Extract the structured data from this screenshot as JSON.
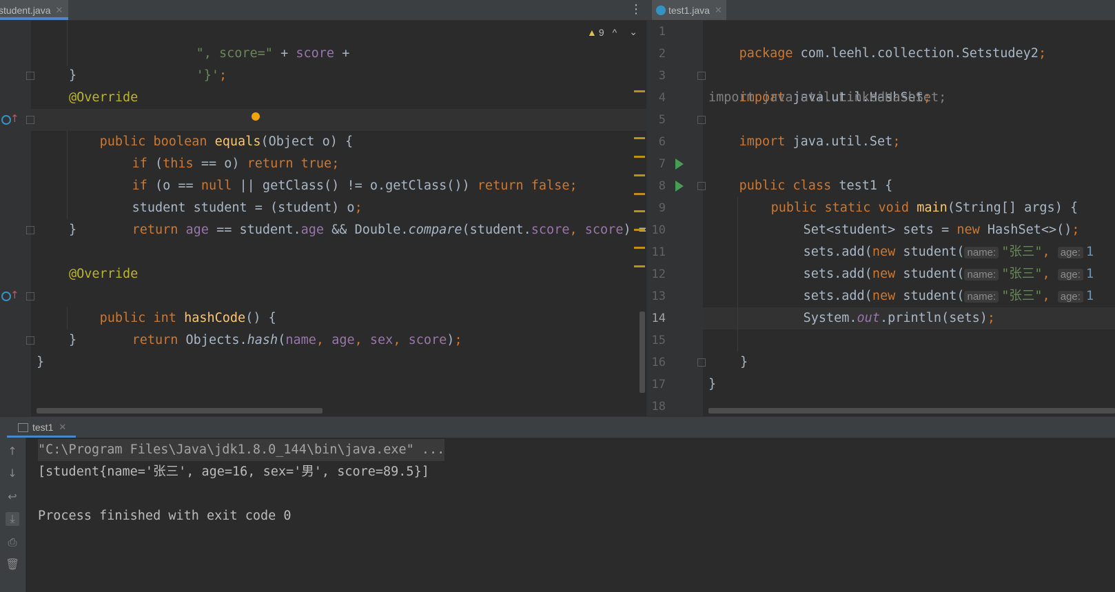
{
  "left_tab": {
    "label": "student.java",
    "close": "✕"
  },
  "left_menu_glyph": "⋮",
  "right_tab": {
    "label": "test1.java",
    "close": "✕"
  },
  "warnings": {
    "count": "9",
    "up": "^",
    "down": "⌄"
  },
  "left_code": {
    "l0": {
      "a": "\", score=\"",
      "b": " + ",
      "c": "score",
      "d": " +"
    },
    "l1": {
      "a": "'}'",
      "b": ";"
    },
    "l2": "}",
    "l3": "@Override",
    "l4": {
      "kw1": "public ",
      "kw2": "boolean ",
      "fn": "equals",
      "rest": "(Object o) {"
    },
    "l5": {
      "kw1": "if ",
      "p1": "(",
      "kw2": "this",
      "p2": " == o) ",
      "kw3": "return true",
      "semi": ";"
    },
    "l6": {
      "kw1": "if ",
      "p1": "(o == ",
      "kw2": "null",
      "p2": " || getClass() != o.getClass()) ",
      "kw3": "return false",
      "semi": ";"
    },
    "l7": {
      "a": "student student = (student) o",
      "semi": ";"
    },
    "l8": {
      "kw": "return ",
      "f1": "age",
      "p1": " == student.",
      "f2": "age",
      "p2": " && Double.",
      "m": "compare",
      "p3": "(student.",
      "f3": "score",
      "c1": ", ",
      "f4": "score",
      "p4": ") =="
    },
    "l9": "}",
    "l11": "@Override",
    "l12": {
      "kw1": "public ",
      "kw2": "int ",
      "fn": "hashCode",
      "rest": "() {"
    },
    "l13": {
      "kw": "return ",
      "p1": "Objects.",
      "m": "hash",
      "p2": "(",
      "f1": "name",
      "c1": ", ",
      "f2": "age",
      "c2": ", ",
      "f3": "sex",
      "c3": ", ",
      "f4": "score",
      "p3": ")",
      "semi": ";"
    },
    "l14": "}",
    "l15": "}"
  },
  "right_code": {
    "line_numbers": [
      "1",
      "2",
      "3",
      "4",
      "5",
      "6",
      "7",
      "8",
      "9",
      "10",
      "11",
      "12",
      "13",
      "14",
      "15",
      "16",
      "17",
      "18"
    ],
    "l1": {
      "kw": "package ",
      "a": "com.leehl.collection.Setstudey2",
      "semi": ";"
    },
    "l3": {
      "kw": "import ",
      "a": "java.util.HashSet",
      "semi": ";"
    },
    "l4": "import java.util.LinkedHashSet;",
    "l5": {
      "kw": "import ",
      "a": "java.util.Set",
      "semi": ";"
    },
    "l7": {
      "kw1": "public ",
      "kw2": "class ",
      "a": "test1 {"
    },
    "l8": {
      "kw1": "public ",
      "kw2": "static ",
      "kw3": "void ",
      "fn": "main",
      "a": "(String[] args) {"
    },
    "l9": {
      "a": "Set<student> sets = ",
      "kw": "new ",
      "b": "HashSet<>()",
      "semi": ";"
    },
    "add_line": {
      "a": "sets.add(",
      "kw": "new ",
      "b": "student(",
      "hint1": "name:",
      "str": "\"张三\"",
      "comma": ",",
      "hint2": "age:",
      "num": "1"
    },
    "l13": {
      "a": "System.",
      "f": "out",
      "b": ".println(sets)",
      "semi": ";"
    },
    "l16": "}",
    "l17": "}"
  },
  "console": {
    "tab_label": "test1",
    "tab_close": "✕",
    "line1": "\"C:\\Program Files\\Java\\jdk1.8.0_144\\bin\\java.exe\" ...",
    "line2": "[student{name='张三', age=16, sex='男', score=89.5}]",
    "line4": "Process finished with exit code 0"
  }
}
